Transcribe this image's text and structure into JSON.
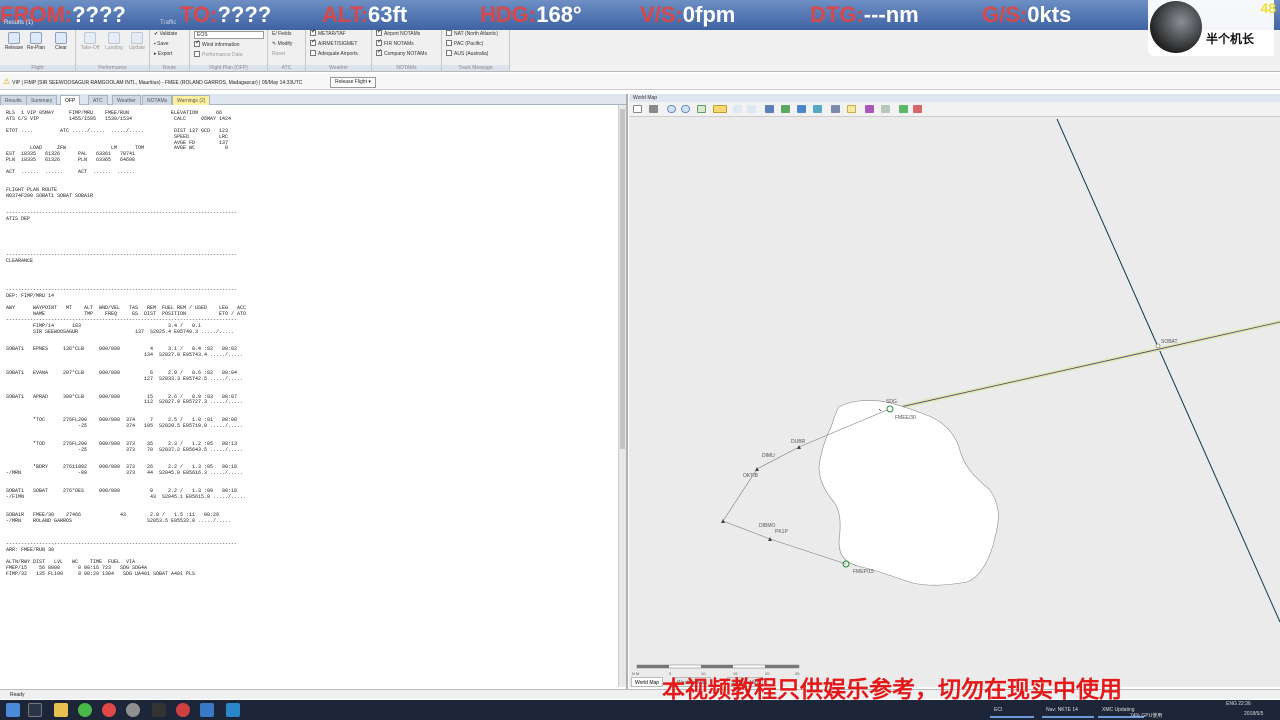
{
  "flight_bar": {
    "from_label": "FROM:",
    "from_value": "????",
    "to_label": "TO:",
    "to_value": "????",
    "alt_label": "ALT:",
    "alt_value": "63ft",
    "hdg_label": "HDG:",
    "hdg_value": "168°",
    "vs_label": "V/S:",
    "vs_value": "0fpm",
    "dtg_label": "DTG:",
    "dtg_value": "---nm",
    "gs_label": "G/S:",
    "gs_value": "0kts"
  },
  "fps": "48",
  "channel": {
    "name": "半个机长"
  },
  "ribbon": {
    "tab_results": "Results (1)",
    "tab_traffic": "Traffic",
    "release_label": "Release",
    "replan_label": "Re-Plan",
    "clear_label": "Clear",
    "takeoff_label": "Take-Off",
    "landing_label": "Landing",
    "update_label": "Update",
    "validate_label": "Validate",
    "save_label": "Save",
    "export_label": "Export",
    "eos_value": "EOS",
    "wind_info": "Wind information",
    "perf_data": "Performance Data",
    "efields": "E/ Fields",
    "modify": "Modify",
    "reset": "Reset",
    "metar": "METAR/TAF",
    "airmet": "AIRMET/SIGMET",
    "adequate": "Adequate Airports",
    "airport_notams": "Airport NOTAMs",
    "fir_notams": "FIR NOTAMs",
    "company_notams": "Company NOTAMs",
    "nat": "NAT (North Atlantic)",
    "pac": "PAC (Pacific)",
    "aus": "AUS (Australia)",
    "groups": [
      "Flight",
      "Performance",
      "Route",
      "Flight Plan (OFP)",
      "ATC",
      "Weather",
      "NOTAMs",
      "Track Message"
    ]
  },
  "info_bar": {
    "text": "VIP | FIMP (SIR SEEWOOSAGUR RAMGOOLAM INTL, Mauritius) - FMEE (ROLAND GARROS, Madagascar) | 05/May 14:33UTC",
    "release_button": "Release Flight"
  },
  "left_tabs": [
    "Results",
    "Summary",
    "OFP",
    "ATC",
    "Weather",
    "NOTAMs",
    "Warnings (2)"
  ],
  "active_left_tab": "OFP",
  "ofp_text": "RLS  1 VIP 05MAY     FIMP/MRU    FMEE/RUN              ELEVATION      66\nATS C/S VIP          1455/1505   1530/1534              CALC     05MAY 1424\n\nETOT ....         ATC ...../.....  ...../.....          DIST 137 GCD   123\n                                                        SPEED          LRC\n                                                        AVGE FD        137\n        LOAD     ZFW               LM      TOM          AVGE WC          0\nEST  18335   61326      PAL   63361   78741\nPLN  18335   61326      PLN   63365   64698\n\nACT  ......  ......     ACT  ......  ......\n\n\nFLIGHT PLAN ROUTE\nN0374F200 SOBAT1 SOBAT SOBA1R\n\n\n-----------------------------------------------------------------------------\nATIS DEP\n\n\n\n\n\n-----------------------------------------------------------------------------\nCLEARANCE\n\n\n\n\n-----------------------------------------------------------------------------\nDEP: FIMP/MRU 14\n\nAWY      WAYPOINT   MT    ALT  WND/VEL   TAS   REM  FUEL REM / USED    LEG   ACC\n         NAME             TMP    FREQ     GS  DIST  POSITION           ETO / ATO\n-----------------------------------------------------------------------------\n         FIMP/14      183                             3.4 /   0.1\n         SIR SEEWOOSAGUR                   137  S2025.4 E05740.3 ...../.....\n\n\nSOBAT1   EPNES     136°CLB     000/000          4     3.1 /   0.4 :02   00:02\n                                              134  S2027.0 E05743.4 ...../.....\n\n\nSOBAT1   EVANA     207°CLB     000/000          6     2.9 /   0.6 :02   00:04\n                                              127  S2033.3 E05742.5 ...../.....\n\n\nSOBAT1   APRAD     309°CLB     000/000         15     2.6 /   0.9 :03   00:07\n                                              112  S2027.9 E05727.3 ...../.....\n\n\n         *TOC      276FL200    000/000  374     7     2.5 /   1.0 :01   00:08\n                        -25             374   105  S2020.5 E05719.0 ...../.....\n\n\n         *TOD      276FL200    000/000  373    35     2.3 /   1.2 :05   00:13\n                        -25             373    70  S2037.2 E05643.5 ...../.....\n\n\n         *BDRY     27611992    000/000  373    26     2.2 /   1.3 :05   00:18\n-/MRN                   -09             373    44  S2045.0 E05616.3 ...../.....\n\n\nSOBAT1   SOBAT     276°DES     000/000          0     2.2 /   1.3 :00   00:18\n-/FIMN                                          43  S2045.1 E05615.9 ...../.....\n\n\nSOBA1R   FMEE/30    27466             43        2.0 /   1.5 :11   00:29\n-/MRN    ROLAND GARROS                         S2053.5 E05532.0 ...../.....\n\n\n\n-----------------------------------------------------------------------------\nARR: FMEE/RUN 30\n\nALTN/RWY DIST   LVL   WC    TIME  FUEL  VIA\nFMEP/15    56 8000      0 00:16 723   SDG SDG4A\nFIMP/32   135 FL190     0 00:29 1304   SDG UA401 SOBAT A401 PLS",
  "map": {
    "header": "World Map",
    "labels": {
      "soba": "SOBAT",
      "fmee": "FMEE/30",
      "fmep": "FMEP/15",
      "sdg": "SDG",
      "dibmo": "DIBMO",
      "ktb": "OKTIB",
      "dimu": "DIMU",
      "dubr": "DUBR",
      "pkl": "PK1P"
    },
    "scale": {
      "unit": "N M",
      "ticks": [
        "0",
        "5",
        "10",
        "15",
        "20",
        "25"
      ]
    },
    "tabs": [
      "World Map",
      "Weather Map",
      "Surface Map"
    ]
  },
  "status": {
    "text": "Ready"
  },
  "taskbar": {
    "apps": [
      "ECI",
      "Nav: NKTE 14",
      "XMC Updating",
      "Take Upcoming"
    ],
    "tray_line1": "74%   GPU使用",
    "tray_line2": "ENG   22:36",
    "date": "2018/5/5"
  },
  "watermark": "本视频教程只供娱乐参考，切勿在现实中使用"
}
